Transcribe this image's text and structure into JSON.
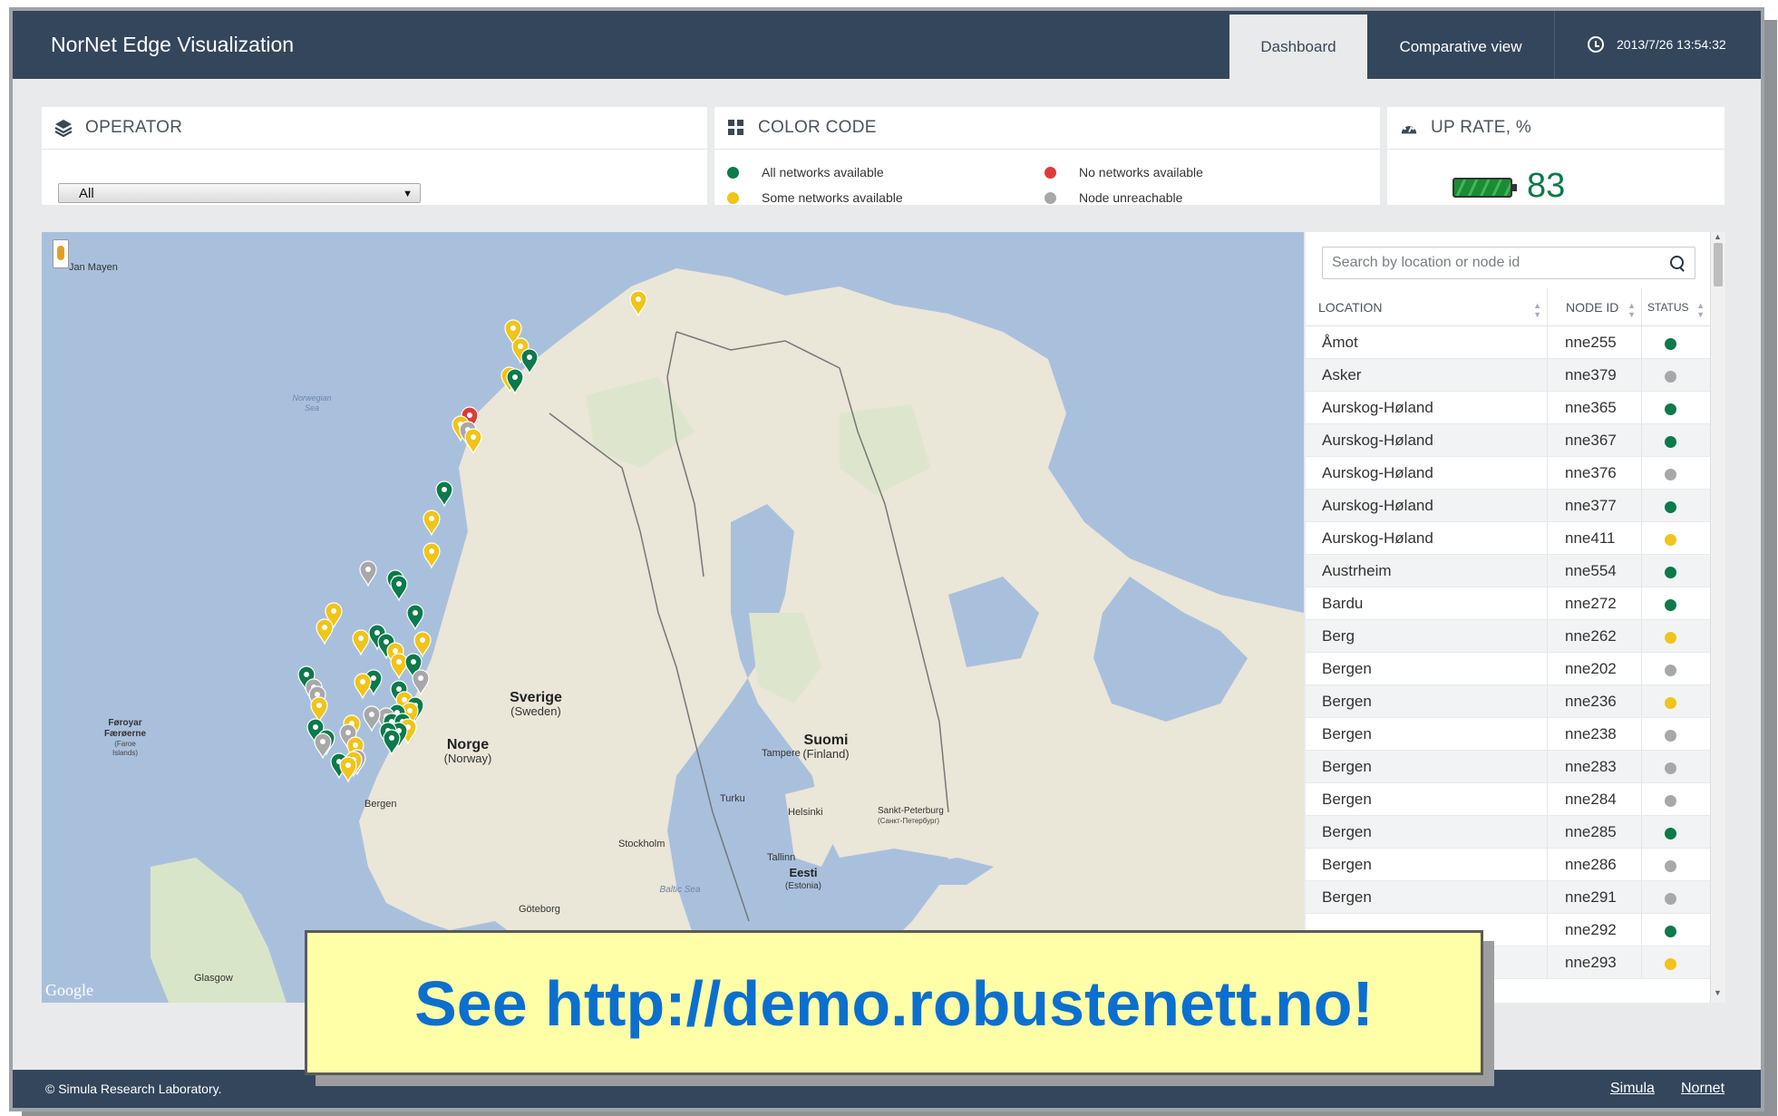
{
  "header": {
    "app_title": "NorNet Edge Visualization",
    "tabs": [
      {
        "label": "Dashboard",
        "active": true
      },
      {
        "label": "Comparative view",
        "active": false
      }
    ],
    "timestamp": "2013/7/26 13:54:32"
  },
  "operator_panel": {
    "title": "OPERATOR",
    "selected": "All"
  },
  "color_code_panel": {
    "title": "COLOR CODE",
    "items": [
      {
        "label": "All networks available",
        "color": "#0c7a4a"
      },
      {
        "label": "Some networks available",
        "color": "#f0c419"
      },
      {
        "label": "No networks available",
        "color": "#e03a3a"
      },
      {
        "label": "Node unreachable",
        "color": "#a8a8a8"
      }
    ]
  },
  "uprate_panel": {
    "title": "UP RATE, %",
    "value": "83",
    "value_pct": 83
  },
  "map": {
    "labels": {
      "jan_mayen": "Jan Mayen",
      "norwegian_sea_1": "Norwegian",
      "norwegian_sea_2": "Sea",
      "sverige": "Sverige",
      "sweden": "(Sweden)",
      "suomi": "Suomi",
      "finland": "(Finland)",
      "norge": "Norge",
      "norway": "(Norway)",
      "foroyar_1": "Føroyar",
      "foroyar_2": "Færøerne",
      "foroyar_3": "(Faroe",
      "foroyar_4": "Islands)",
      "tampere": "Tampere",
      "turku": "Turku",
      "helsinki": "Helsinki",
      "spb_1": "Sankt-Peterburg",
      "spb_2": "(Санкт-Петербург)",
      "stockholm": "Stockholm",
      "tallinn": "Tallinn",
      "eesti": "Eesti",
      "estonia": "(Estonia)",
      "baltic_sea": "Baltic Sea",
      "goteborg": "Göteborg",
      "bergen": "Bergen",
      "glasgow": "Glasgow",
      "google": "Google"
    }
  },
  "table": {
    "search_placeholder": "Search by location or node id",
    "columns": [
      "LOCATION",
      "NODE ID",
      "STATUS"
    ],
    "rows": [
      {
        "location": "Åmot",
        "node_id": "nne255",
        "status": "all"
      },
      {
        "location": "Asker",
        "node_id": "nne379",
        "status": "unreachable"
      },
      {
        "location": "Aurskog-Høland",
        "node_id": "nne365",
        "status": "all"
      },
      {
        "location": "Aurskog-Høland",
        "node_id": "nne367",
        "status": "all"
      },
      {
        "location": "Aurskog-Høland",
        "node_id": "nne376",
        "status": "unreachable"
      },
      {
        "location": "Aurskog-Høland",
        "node_id": "nne377",
        "status": "all"
      },
      {
        "location": "Aurskog-Høland",
        "node_id": "nne411",
        "status": "some"
      },
      {
        "location": "Austrheim",
        "node_id": "nne554",
        "status": "all"
      },
      {
        "location": "Bardu",
        "node_id": "nne272",
        "status": "all"
      },
      {
        "location": "Berg",
        "node_id": "nne262",
        "status": "some"
      },
      {
        "location": "Bergen",
        "node_id": "nne202",
        "status": "unreachable"
      },
      {
        "location": "Bergen",
        "node_id": "nne236",
        "status": "some"
      },
      {
        "location": "Bergen",
        "node_id": "nne238",
        "status": "unreachable"
      },
      {
        "location": "Bergen",
        "node_id": "nne283",
        "status": "unreachable"
      },
      {
        "location": "Bergen",
        "node_id": "nne284",
        "status": "unreachable"
      },
      {
        "location": "Bergen",
        "node_id": "nne285",
        "status": "all"
      },
      {
        "location": "Bergen",
        "node_id": "nne286",
        "status": "unreachable"
      },
      {
        "location": "Bergen",
        "node_id": "nne291",
        "status": "unreachable"
      },
      {
        "location": "",
        "node_id": "nne292",
        "status": "all"
      },
      {
        "location": "",
        "node_id": "nne293",
        "status": "some"
      }
    ]
  },
  "status_colors": {
    "all": "#0c7a4a",
    "some": "#f0c419",
    "none": "#e03a3a",
    "unreachable": "#a8a8a8"
  },
  "footer": {
    "copyright": "© Simula Research Laboratory.",
    "links": [
      "Simula",
      "Nornet"
    ]
  },
  "callout": {
    "text": "See http://demo.robustenett.no!"
  }
}
